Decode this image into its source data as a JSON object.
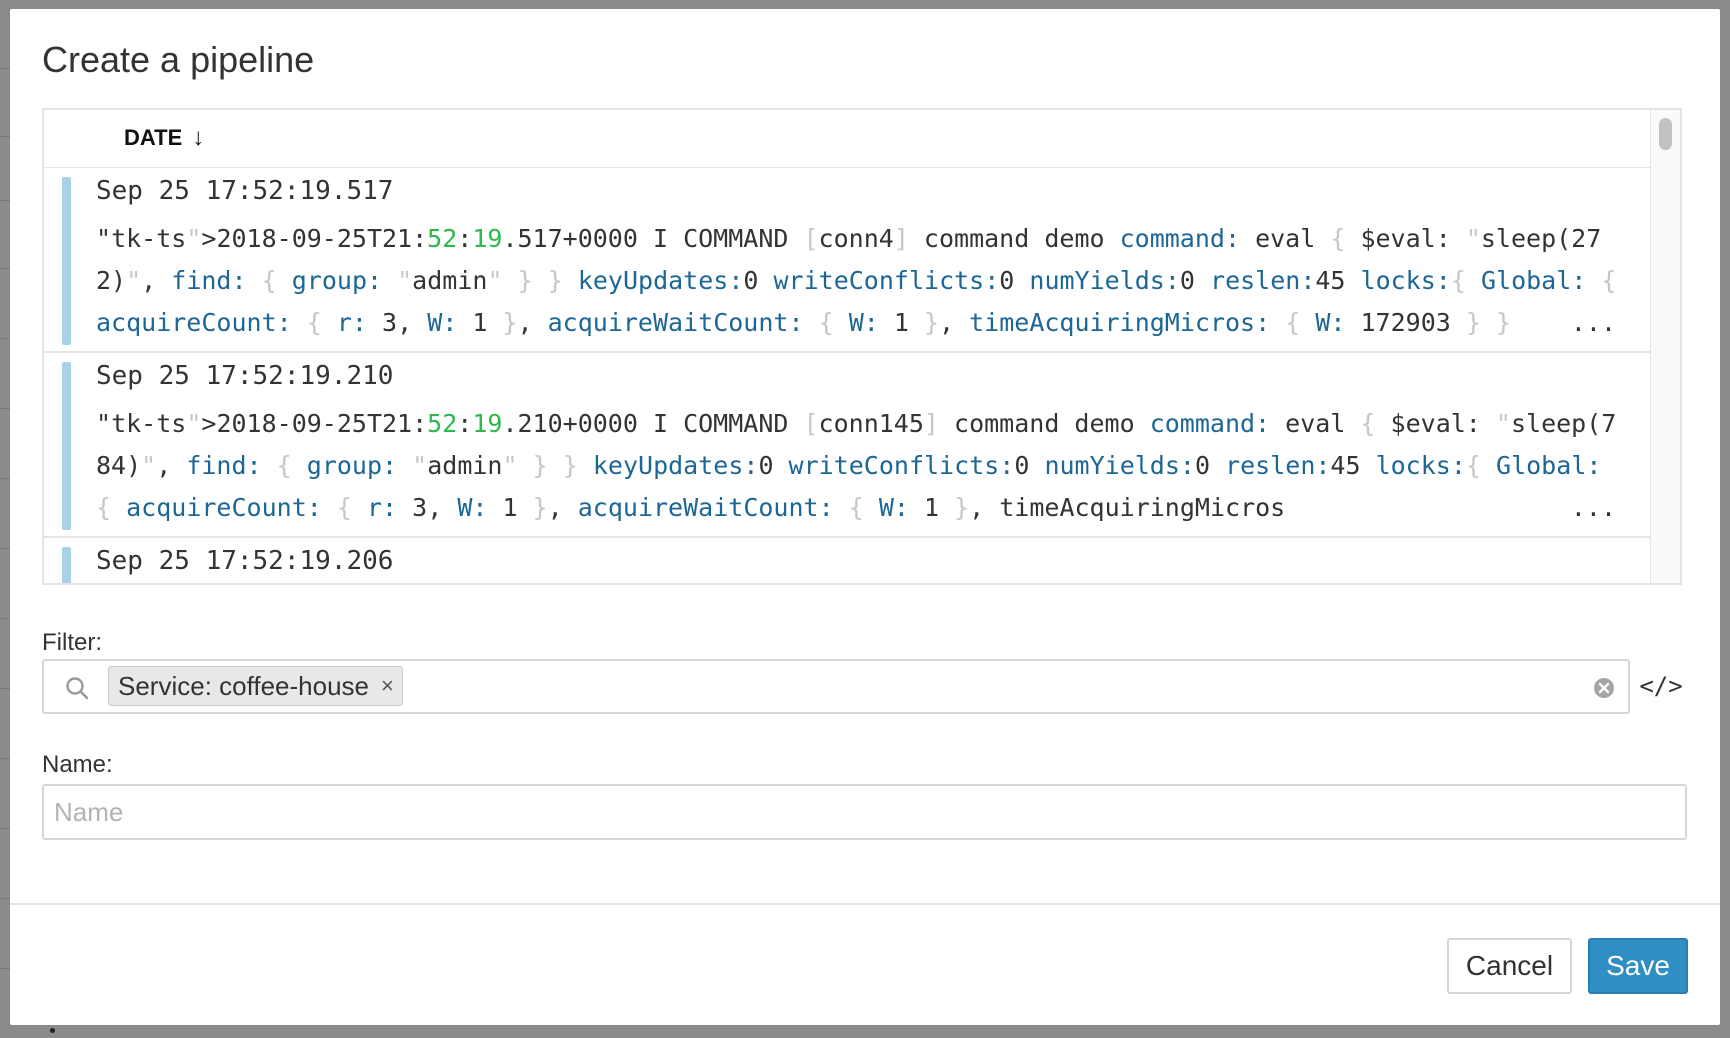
{
  "modal": {
    "title": "Create a pipeline"
  },
  "log_viewer": {
    "date_header": "DATE",
    "sort_arrow": "↓",
    "entries": [
      {
        "date": "Sep 25 17:52:19.517",
        "message": "2018-09-25T21:52:19.517+0000 I COMMAND [conn4] command demo command: eval { $eval: \"sleep(272)\", find: { group: \"admin\" } } keyUpdates:0 writeConflicts:0 numYields:0 reslen:45 locks:{ Global: { acquireCount: { r: 3, W: 1 }, acquireWaitCount: { W: 1 }, timeAcquiringMicros: { W: 172903 } } ..."
      },
      {
        "date": "Sep 25 17:52:19.210",
        "message": "2018-09-25T21:52:19.210+0000 I COMMAND [conn145] command demo command: eval { $eval: \"sleep(784)\", find: { group: \"admin\" } } keyUpdates:0 writeConflicts:0 numYields:0 reslen:45 locks:{ Global: { acquireCount: { r: 3, W: 1 }, acquireWaitCount: { W: 1 }, timeAcquiringMicros ..."
      },
      {
        "date": "Sep 25 17:52:19.206",
        "message": ""
      }
    ],
    "ellipsis": "..."
  },
  "filter": {
    "label": "Filter:",
    "tag_label": "Service: coffee-house",
    "tag_remove": "×",
    "code_toggle": "</>",
    "icons": [
      "search-icon",
      "clear-icon"
    ]
  },
  "name_field": {
    "label": "Name:",
    "value": "",
    "placeholder": "Name"
  },
  "footer": {
    "cancel_label": "Cancel",
    "save_label": "Save"
  },
  "colors": {
    "accent": "#2f8fc4",
    "row_accent": "#a8d1e8",
    "log_key": "#1c6795",
    "log_number": "#2fb84e"
  }
}
